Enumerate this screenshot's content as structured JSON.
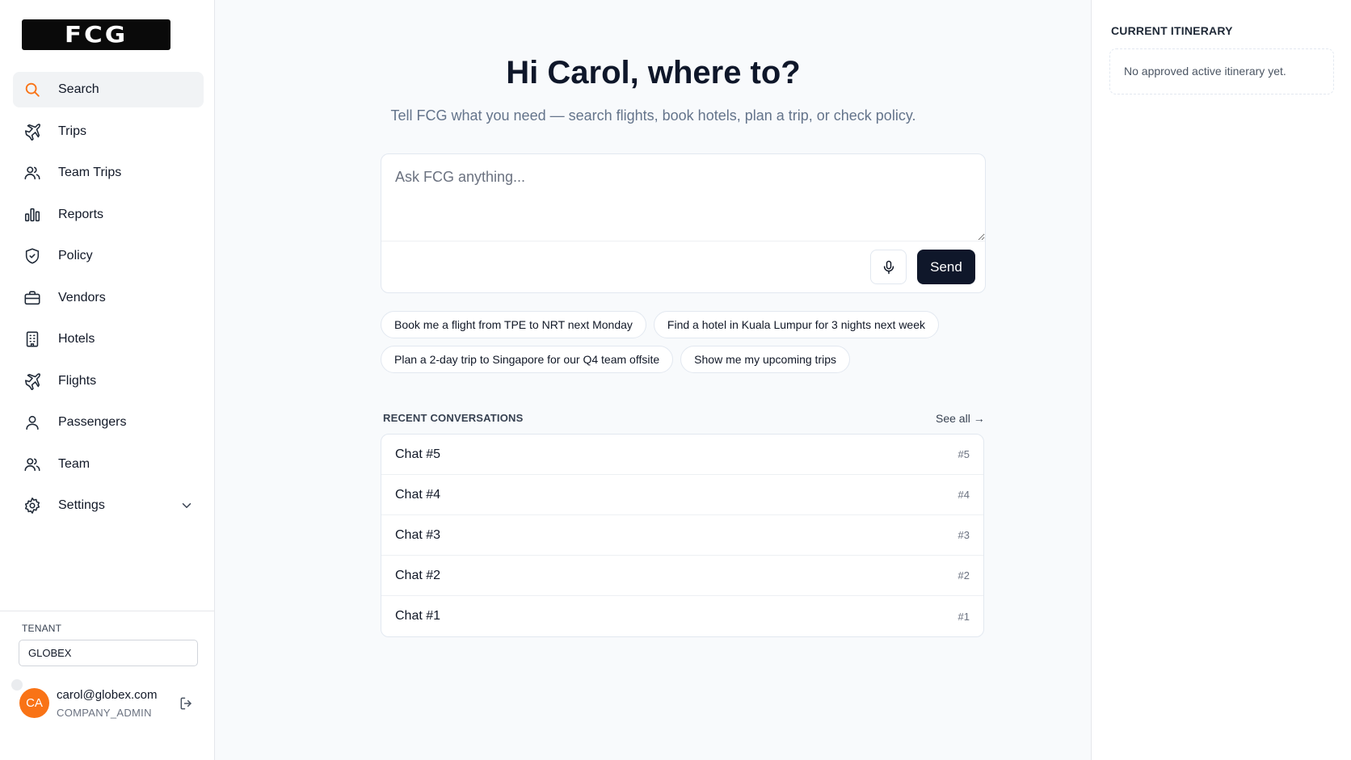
{
  "brand": {
    "logo_text": "FCG"
  },
  "sidebar": {
    "items": [
      {
        "label": "Search",
        "icon": "search-icon"
      },
      {
        "label": "Trips",
        "icon": "plane-icon"
      },
      {
        "label": "Team Trips",
        "icon": "users-icon"
      },
      {
        "label": "Reports",
        "icon": "bar-chart-icon"
      },
      {
        "label": "Policy",
        "icon": "shield-icon"
      },
      {
        "label": "Vendors",
        "icon": "briefcase-icon"
      },
      {
        "label": "Hotels",
        "icon": "building-icon"
      },
      {
        "label": "Flights",
        "icon": "plane-icon"
      },
      {
        "label": "Passengers",
        "icon": "user-icon"
      },
      {
        "label": "Team",
        "icon": "users-icon"
      },
      {
        "label": "Settings",
        "icon": "gear-icon"
      }
    ],
    "active_item": "Search",
    "tenant": {
      "label": "TENANT",
      "value": "GLOBEX"
    },
    "user": {
      "initials": "CA",
      "email": "carol@globex.com",
      "role": "COMPANY_ADMIN"
    }
  },
  "main": {
    "greeting": "Hi Carol, where to?",
    "subtitle": "Tell FCG what you need — search flights, book hotels, plan a trip, or check policy.",
    "ask": {
      "placeholder": "Ask FCG anything...",
      "value": "",
      "send_label": "Send"
    },
    "suggestions": [
      "Book me a flight from TPE to NRT next Monday",
      "Find a hotel in Kuala Lumpur for 3 nights next week",
      "Plan a 2-day trip to Singapore for our Q4 team offsite",
      "Show me my upcoming trips"
    ],
    "recent": {
      "heading": "RECENT CONVERSATIONS",
      "see_all": "See all →",
      "items": [
        {
          "title": "Chat #5",
          "tag": "#5"
        },
        {
          "title": "Chat #4",
          "tag": "#4"
        },
        {
          "title": "Chat #3",
          "tag": "#3"
        },
        {
          "title": "Chat #2",
          "tag": "#2"
        },
        {
          "title": "Chat #1",
          "tag": "#1"
        }
      ]
    }
  },
  "itinerary": {
    "title": "CURRENT ITINERARY",
    "empty_text": "No approved active itinerary yet."
  },
  "colors": {
    "accent": "#f97316",
    "primary": "#0f172a",
    "muted": "#64748b"
  }
}
